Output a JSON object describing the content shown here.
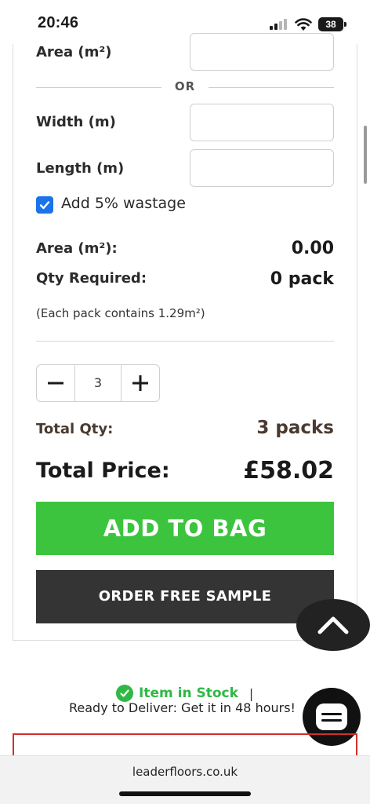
{
  "status_bar": {
    "time": "20:46",
    "battery": "38"
  },
  "form": {
    "area_label": "Area (m²)",
    "or_text": "OR",
    "width_label": "Width (m)",
    "length_label": "Length (m)",
    "width_value": "",
    "length_value": "",
    "area_value": "",
    "wastage_label": "Add 5% wastage",
    "wastage_checked": true
  },
  "summary": {
    "area_label": "Area (m²):",
    "area_value": "0.00",
    "qty_label": "Qty Required:",
    "qty_value": "0 pack",
    "pack_note": "(Each pack contains 1.29m²)"
  },
  "stepper": {
    "value": "3"
  },
  "totals": {
    "total_qty_label": "Total Qty:",
    "total_qty_value": "3 packs",
    "total_price_label": "Total Price:",
    "total_price_value": "£58.02"
  },
  "actions": {
    "add_to_bag": "ADD TO BAG",
    "order_sample": "ORDER FREE SAMPLE"
  },
  "stock": {
    "status": "Item in Stock",
    "separator": "|",
    "delivery": "Ready to Deliver: Get it in 48 hours!"
  },
  "browser": {
    "url": "leaderfloors.co.uk"
  },
  "colors": {
    "add_button": "#3cc43f",
    "sample_button": "#343434",
    "stock_green": "#2fb845",
    "checkbox_blue": "#1a73e8"
  }
}
